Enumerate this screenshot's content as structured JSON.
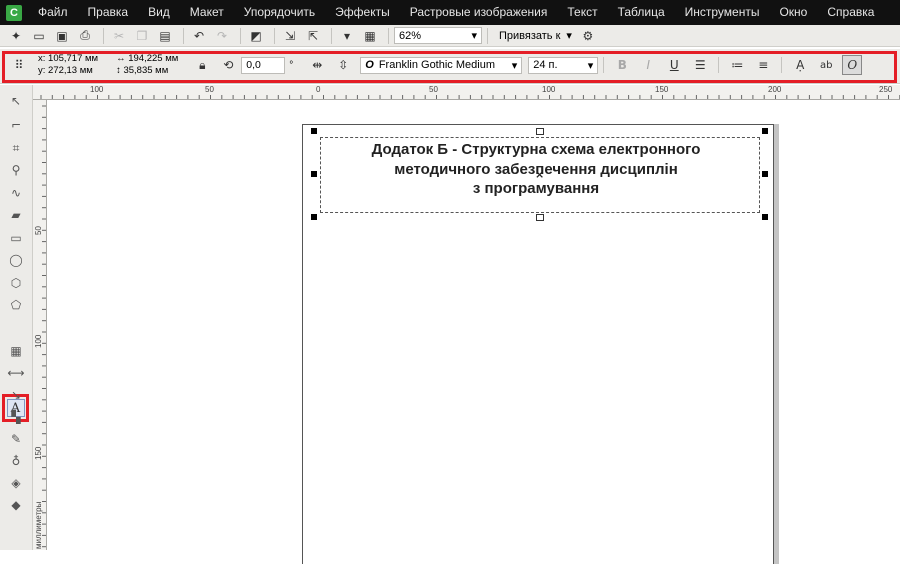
{
  "menu": {
    "items": [
      "Файл",
      "Правка",
      "Вид",
      "Макет",
      "Упорядочить",
      "Эффекты",
      "Растровые изображения",
      "Текст",
      "Таблица",
      "Инструменты",
      "Окно",
      "Справка"
    ]
  },
  "toolbar": {
    "zoom_value": "62%",
    "snap_label": "Привязать к"
  },
  "property_bar": {
    "x_label": "x:",
    "x_value": "105,717 мм",
    "y_label": "y:",
    "y_value": "272,13 мм",
    "width_value": "194,225 мм",
    "height_value": "35,835 мм",
    "rotation_value": "0,0",
    "rotation_unit": "°",
    "font_name": "Franklin Gothic Medium",
    "font_size": "24 п."
  },
  "rulers": {
    "top_labels": [
      "100",
      "50",
      "0",
      "50",
      "100",
      "150",
      "200",
      "250"
    ],
    "left_labels": [
      "50",
      "100",
      "150"
    ],
    "unit_label": "миллиметры"
  },
  "document": {
    "text_line1": "Додаток Б - Структурна схема електронного",
    "text_line2": "методичного забезпечення дисциплін",
    "text_line3": "з програмування"
  },
  "colors": {
    "highlight": "#e41e26",
    "menubar_bg": "#111111"
  }
}
